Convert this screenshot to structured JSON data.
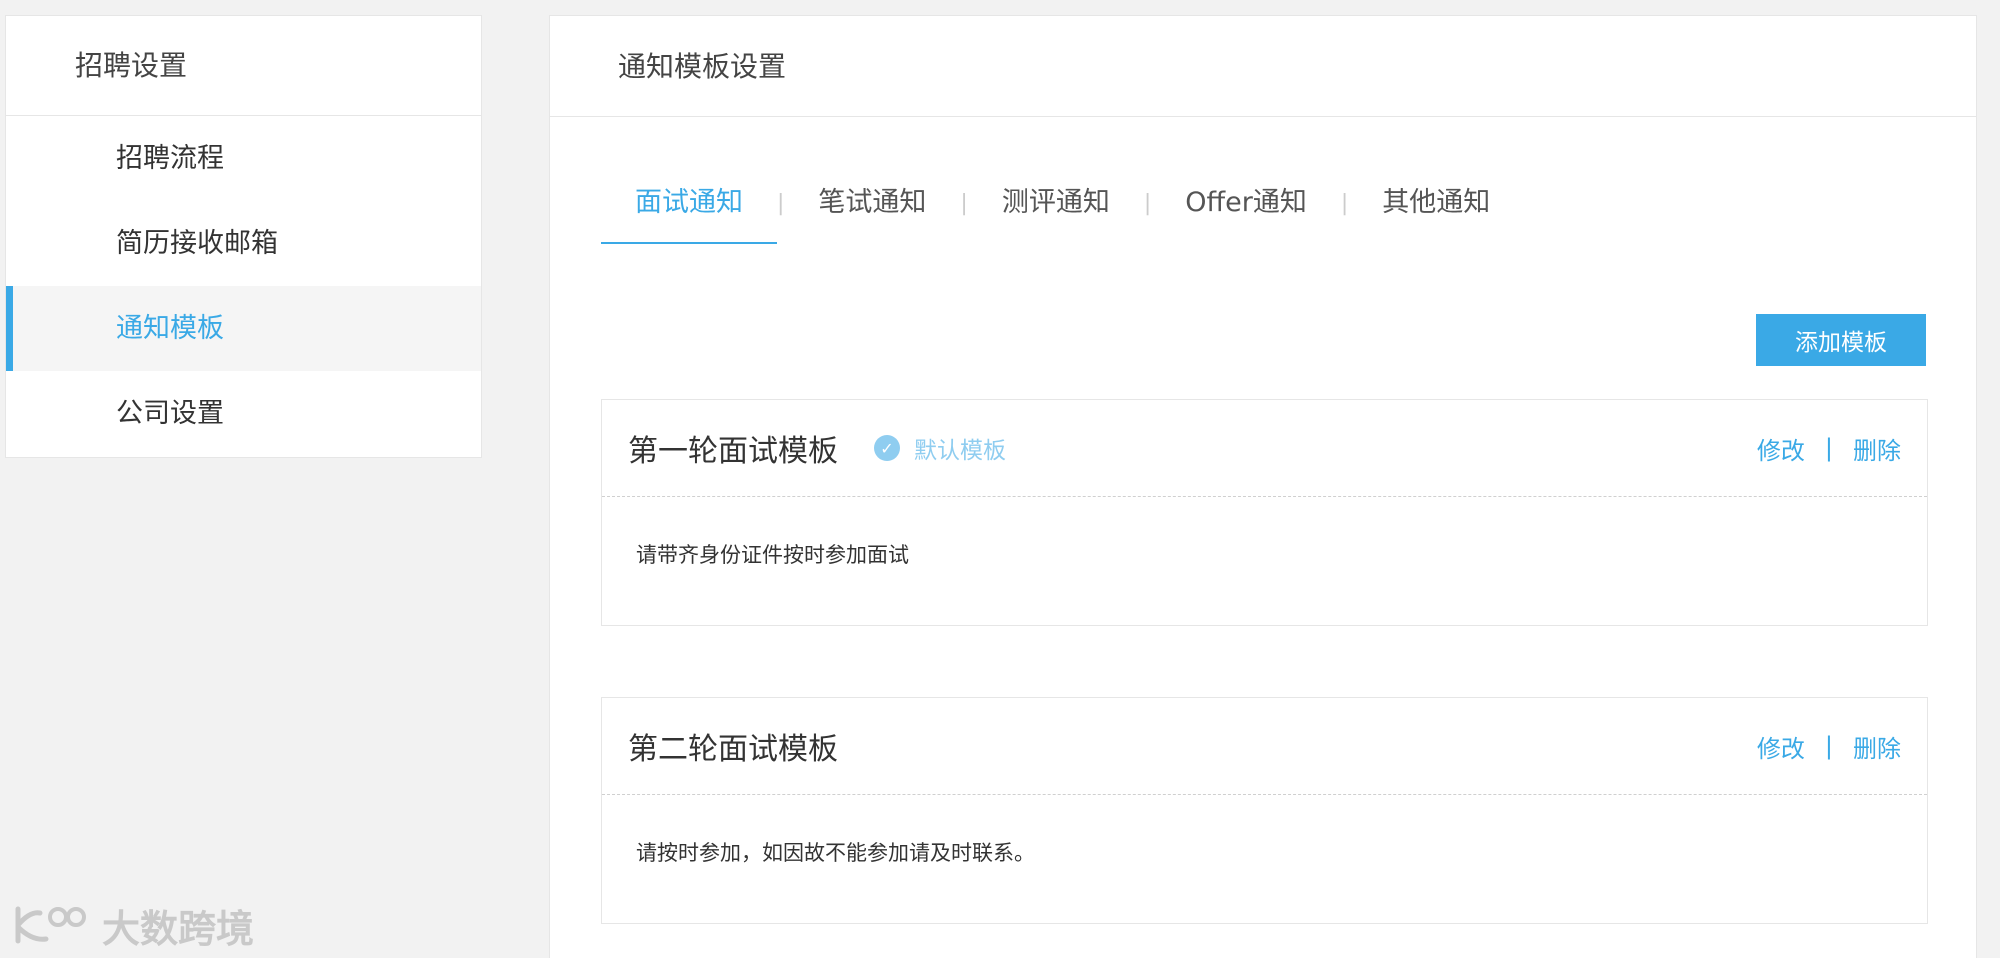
{
  "sidebar": {
    "title": "招聘设置",
    "items": [
      {
        "label": "招聘流程"
      },
      {
        "label": "简历接收邮箱"
      },
      {
        "label": "通知模板"
      },
      {
        "label": "公司设置"
      }
    ]
  },
  "main": {
    "header": "通知模板设置",
    "tabs": [
      {
        "label": "面试通知"
      },
      {
        "label": "笔试通知"
      },
      {
        "label": "测评通知"
      },
      {
        "label": "Offer通知"
      },
      {
        "label": "其他通知"
      }
    ],
    "tab_separator": "|",
    "add_button": "添加模板",
    "templates": [
      {
        "title": "第一轮面试模板",
        "badge": "默认模板",
        "edit": "修改",
        "delete": "删除",
        "separator": "|",
        "body": "请带齐身份证件按时参加面试"
      },
      {
        "title": "第二轮面试模板",
        "edit": "修改",
        "delete": "删除",
        "separator": "|",
        "body": "请按时参加，如因故不能参加请及时联系。"
      }
    ]
  },
  "watermark": "大数跨境",
  "colors": {
    "accent": "#3aa9e6",
    "badge": "#8fcdf0",
    "background": "#f2f2f2"
  }
}
